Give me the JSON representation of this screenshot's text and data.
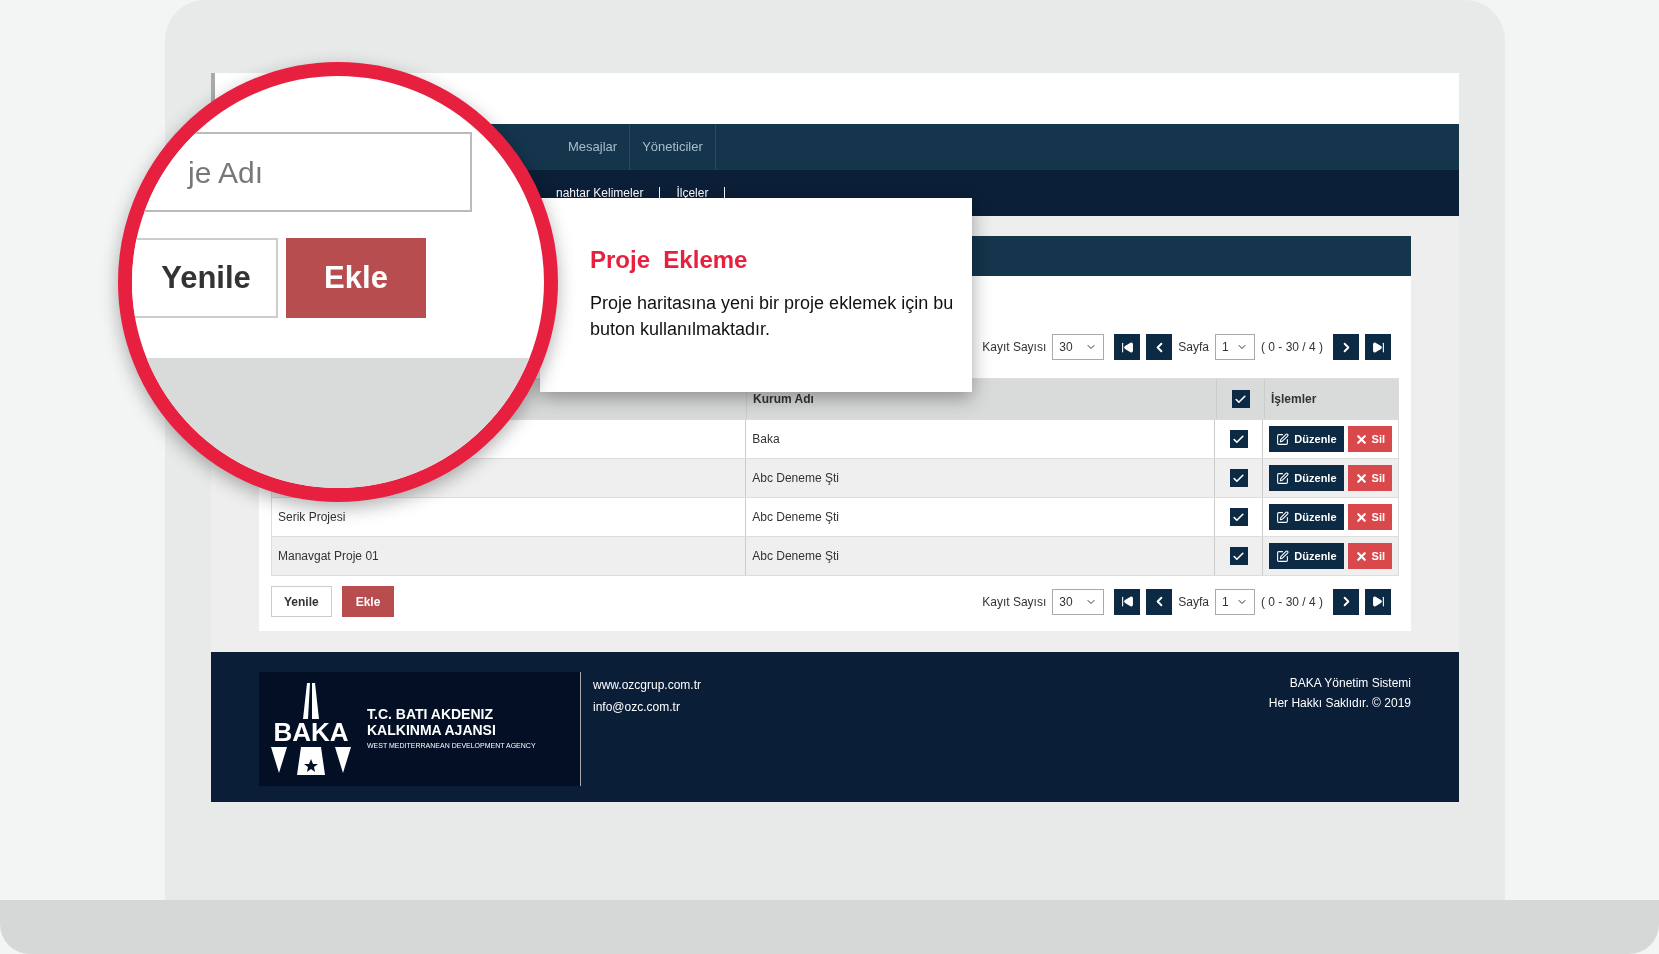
{
  "nav": {
    "items": [
      {
        "label": "Mesajlar"
      },
      {
        "label": "Yöneticiler"
      }
    ]
  },
  "subnav": {
    "items": [
      {
        "label": "nahtar Kelimeler"
      },
      {
        "label": "İlçeler"
      }
    ]
  },
  "pagination_top": {
    "record_label": "Kayıt Sayısı",
    "per_page": "30",
    "page_label": "Sayfa",
    "page": "1",
    "range": "( 0 - 30 / 4 )"
  },
  "table": {
    "columns": [
      {
        "label": "Kurum Adı"
      },
      {
        "kind": "checkbox",
        "checked": true
      },
      {
        "label": "İşlemler"
      }
    ],
    "rows": [
      {
        "name": "",
        "org": "Baka",
        "checked": true,
        "edit_label": "Düzenle",
        "delete_label": "Sil"
      },
      {
        "name": "",
        "org": "Abc Deneme Şti",
        "checked": true,
        "edit_label": "Düzenle",
        "delete_label": "Sil"
      },
      {
        "name": "Serik Projesi",
        "org": "Abc Deneme Şti",
        "checked": true,
        "edit_label": "Düzenle",
        "delete_label": "Sil"
      },
      {
        "name": "Manavgat Proje 01",
        "org": "Abc Deneme Şti",
        "checked": true,
        "edit_label": "Düzenle",
        "delete_label": "Sil"
      }
    ]
  },
  "buttons": {
    "refresh": "Yenile",
    "add": "Ekle"
  },
  "pagination_bottom": {
    "record_label": "Kayıt Sayısı",
    "per_page": "30",
    "page_label": "Sayfa",
    "page": "1",
    "range": "( 0 - 30 / 4 )"
  },
  "footer": {
    "logo_word": "BAKA",
    "org_lines": [
      "T.C. BATI AKDENIZ",
      "KALKINMA AJANSI"
    ],
    "org_subtitle": "WEST MEDITERRANEAN DEVELOPMENT AGENCY",
    "links": [
      "www.ozcgrup.com.tr",
      "info@ozc.com.tr"
    ],
    "system": "BAKA Yönetim Sistemi",
    "copyright": "Her Hakkı Saklıdır. © 2019"
  },
  "magnifier": {
    "field_placeholder": "je Adı",
    "refresh": "Yenile",
    "add": "Ekle"
  },
  "callout": {
    "title": "Proje  Ekleme",
    "text": "Proje haritasına yeni bir proje eklemek için bu buton kullanılmaktadır."
  }
}
